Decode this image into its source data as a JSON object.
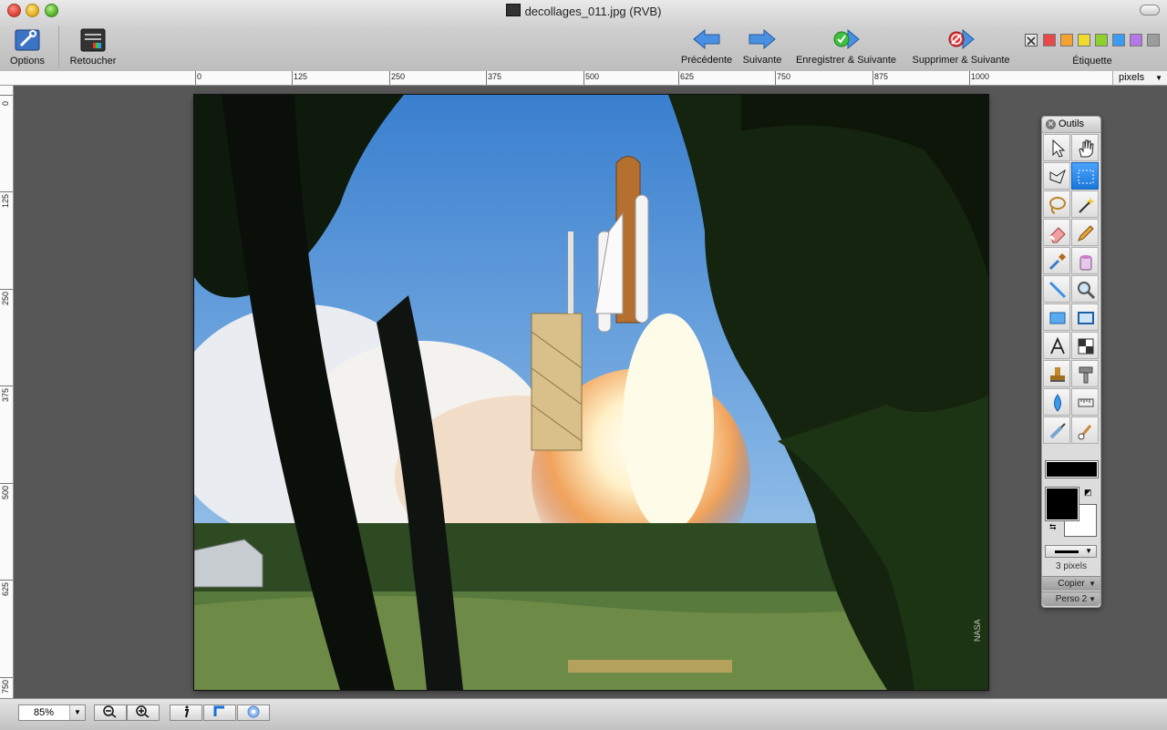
{
  "window": {
    "title": "decollages_011.jpg (RVB)"
  },
  "toolbar": {
    "options_label": "Options",
    "retoucher_label": "Retoucher",
    "precedente_label": "Précédente",
    "suivante_label": "Suivante",
    "enregistrer_label": "Enregistrer & Suivante",
    "supprimer_label": "Supprimer & Suivante",
    "etiquette_label": "Étiquette",
    "label_colors": [
      "#e84a4a",
      "#f3a12f",
      "#eedb2b",
      "#8fd12c",
      "#3b9bf0",
      "#b479e6",
      "#9c9c9c"
    ]
  },
  "ruler": {
    "units": "pixels",
    "top_labels": [
      "0",
      "125",
      "250",
      "375",
      "500",
      "625",
      "750",
      "875",
      "1000"
    ],
    "left_labels": [
      "0",
      "125",
      "250",
      "375",
      "500",
      "625",
      "750"
    ]
  },
  "photo": {
    "watermark": "NASA"
  },
  "tools": {
    "title": "Outils",
    "stroke_size": "3 pixels",
    "copy_label": "Copier",
    "brush_preset": "Perso 2"
  },
  "bottom": {
    "zoom": "85%"
  }
}
